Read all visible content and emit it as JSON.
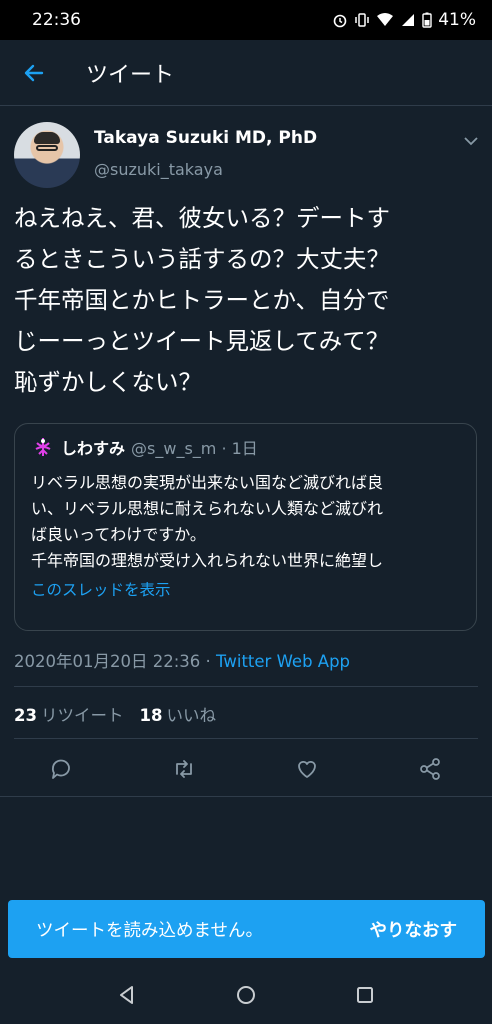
{
  "status_bar": {
    "time": "22:36",
    "battery": "41%"
  },
  "header": {
    "title": "ツイート"
  },
  "tweet": {
    "author_name": "Takaya Suzuki MD, PhD",
    "author_handle": "@suzuki_takaya",
    "text": "ねえねえ、君、彼女いる？デートす\nるときこういう話するの？大丈夫？\n千年帝国とかヒトラーとか、自分で\nじーーっとツイート見返してみて？\n恥ずかしくない？",
    "timestamp": "2020年01月20日 22:36",
    "separator": " · ",
    "source": "Twitter Web App",
    "retweets_count": "23",
    "retweets_label": "リツイート",
    "likes_count": "18",
    "likes_label": "いいね"
  },
  "quote": {
    "name": "しわすみ",
    "handle": "@s_w_s_m · 1日",
    "text": "リベラル思想の実現が出来ない国など滅びれば良\nい、リベラル思想に耐えられない人類など滅びれ\nば良いってわけですか。\n千年帝国の理想が受け入れられない世界に絶望し\nてドイツ人と文化を道連れにしようとしたヒト…",
    "thread_link": "このスレッドを表示"
  },
  "toast": {
    "message": "ツイートを読み込めません。",
    "retry_label": "やりなおす"
  },
  "colors": {
    "background": "#15202b",
    "accent": "#1da1f2",
    "secondary_text": "#8899a6",
    "border": "#38444d"
  },
  "icons": {
    "back": "arrow-left-icon",
    "caret": "chevron-down-icon",
    "reply": "speech-bubble-icon",
    "retweet": "retweet-icon",
    "like": "heart-icon",
    "share": "share-icon",
    "nav_back": "triangle-back-icon",
    "nav_home": "circle-home-icon",
    "nav_recents": "square-recents-icon"
  }
}
